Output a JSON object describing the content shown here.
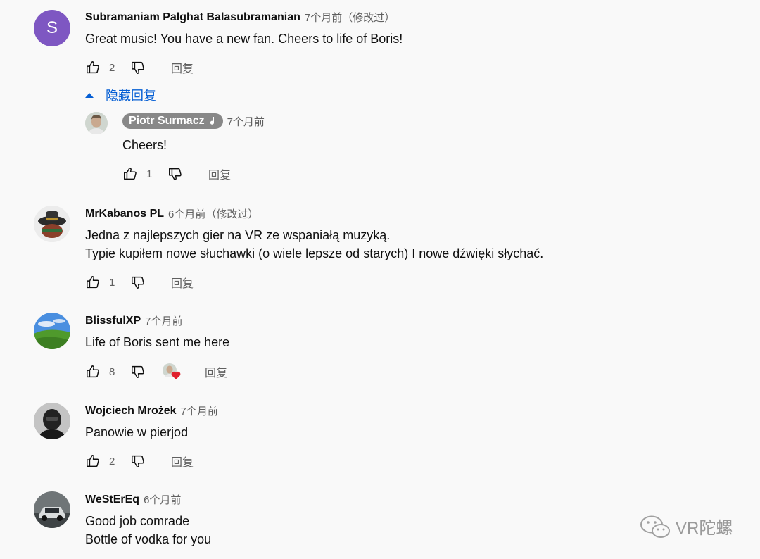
{
  "comments": [
    {
      "author": "Subramaniam Palghat Balasubramanian",
      "meta": "7个月前（修改过）",
      "avatar_letter": "S",
      "text": [
        "Great music! You have a new fan. Cheers to life of Boris!"
      ],
      "likes": "2",
      "reply": "回复"
    },
    {
      "author": "MrKabanos PL",
      "meta": "6个月前（修改过）",
      "text": [
        "Jedna z najlepszych gier na VR ze wspaniałą muzyką.",
        "Typie kupiłem nowe słuchawki (o wiele lepsze od starych) I nowe dźwięki słychać."
      ],
      "likes": "1",
      "reply": "回复"
    },
    {
      "author": "BlissfulXP",
      "meta": "7个月前",
      "text": [
        "Life of Boris sent me here"
      ],
      "likes": "8",
      "reply": "回复"
    },
    {
      "author": "Wojciech Mrożek",
      "meta": "7个月前",
      "text": [
        "Panowie w pierjod"
      ],
      "likes": "2",
      "reply": "回复"
    },
    {
      "author": "WeStErEq",
      "meta": "6个月前",
      "text": [
        "Good job comrade",
        "Bottle of vodka for you"
      ]
    }
  ],
  "hide_replies_label": "隐藏回复",
  "reply_thread": {
    "author": "Piotr Surmacz",
    "author_icon": "music-note-icon",
    "meta": "7个月前",
    "text": "Cheers!",
    "likes": "1",
    "reply": "回复"
  },
  "watermark": "VR陀螺",
  "colors": {
    "link_blue": "#065fd4",
    "avatar_purple": "#7e57c2",
    "heart_red": "#e0202d"
  }
}
